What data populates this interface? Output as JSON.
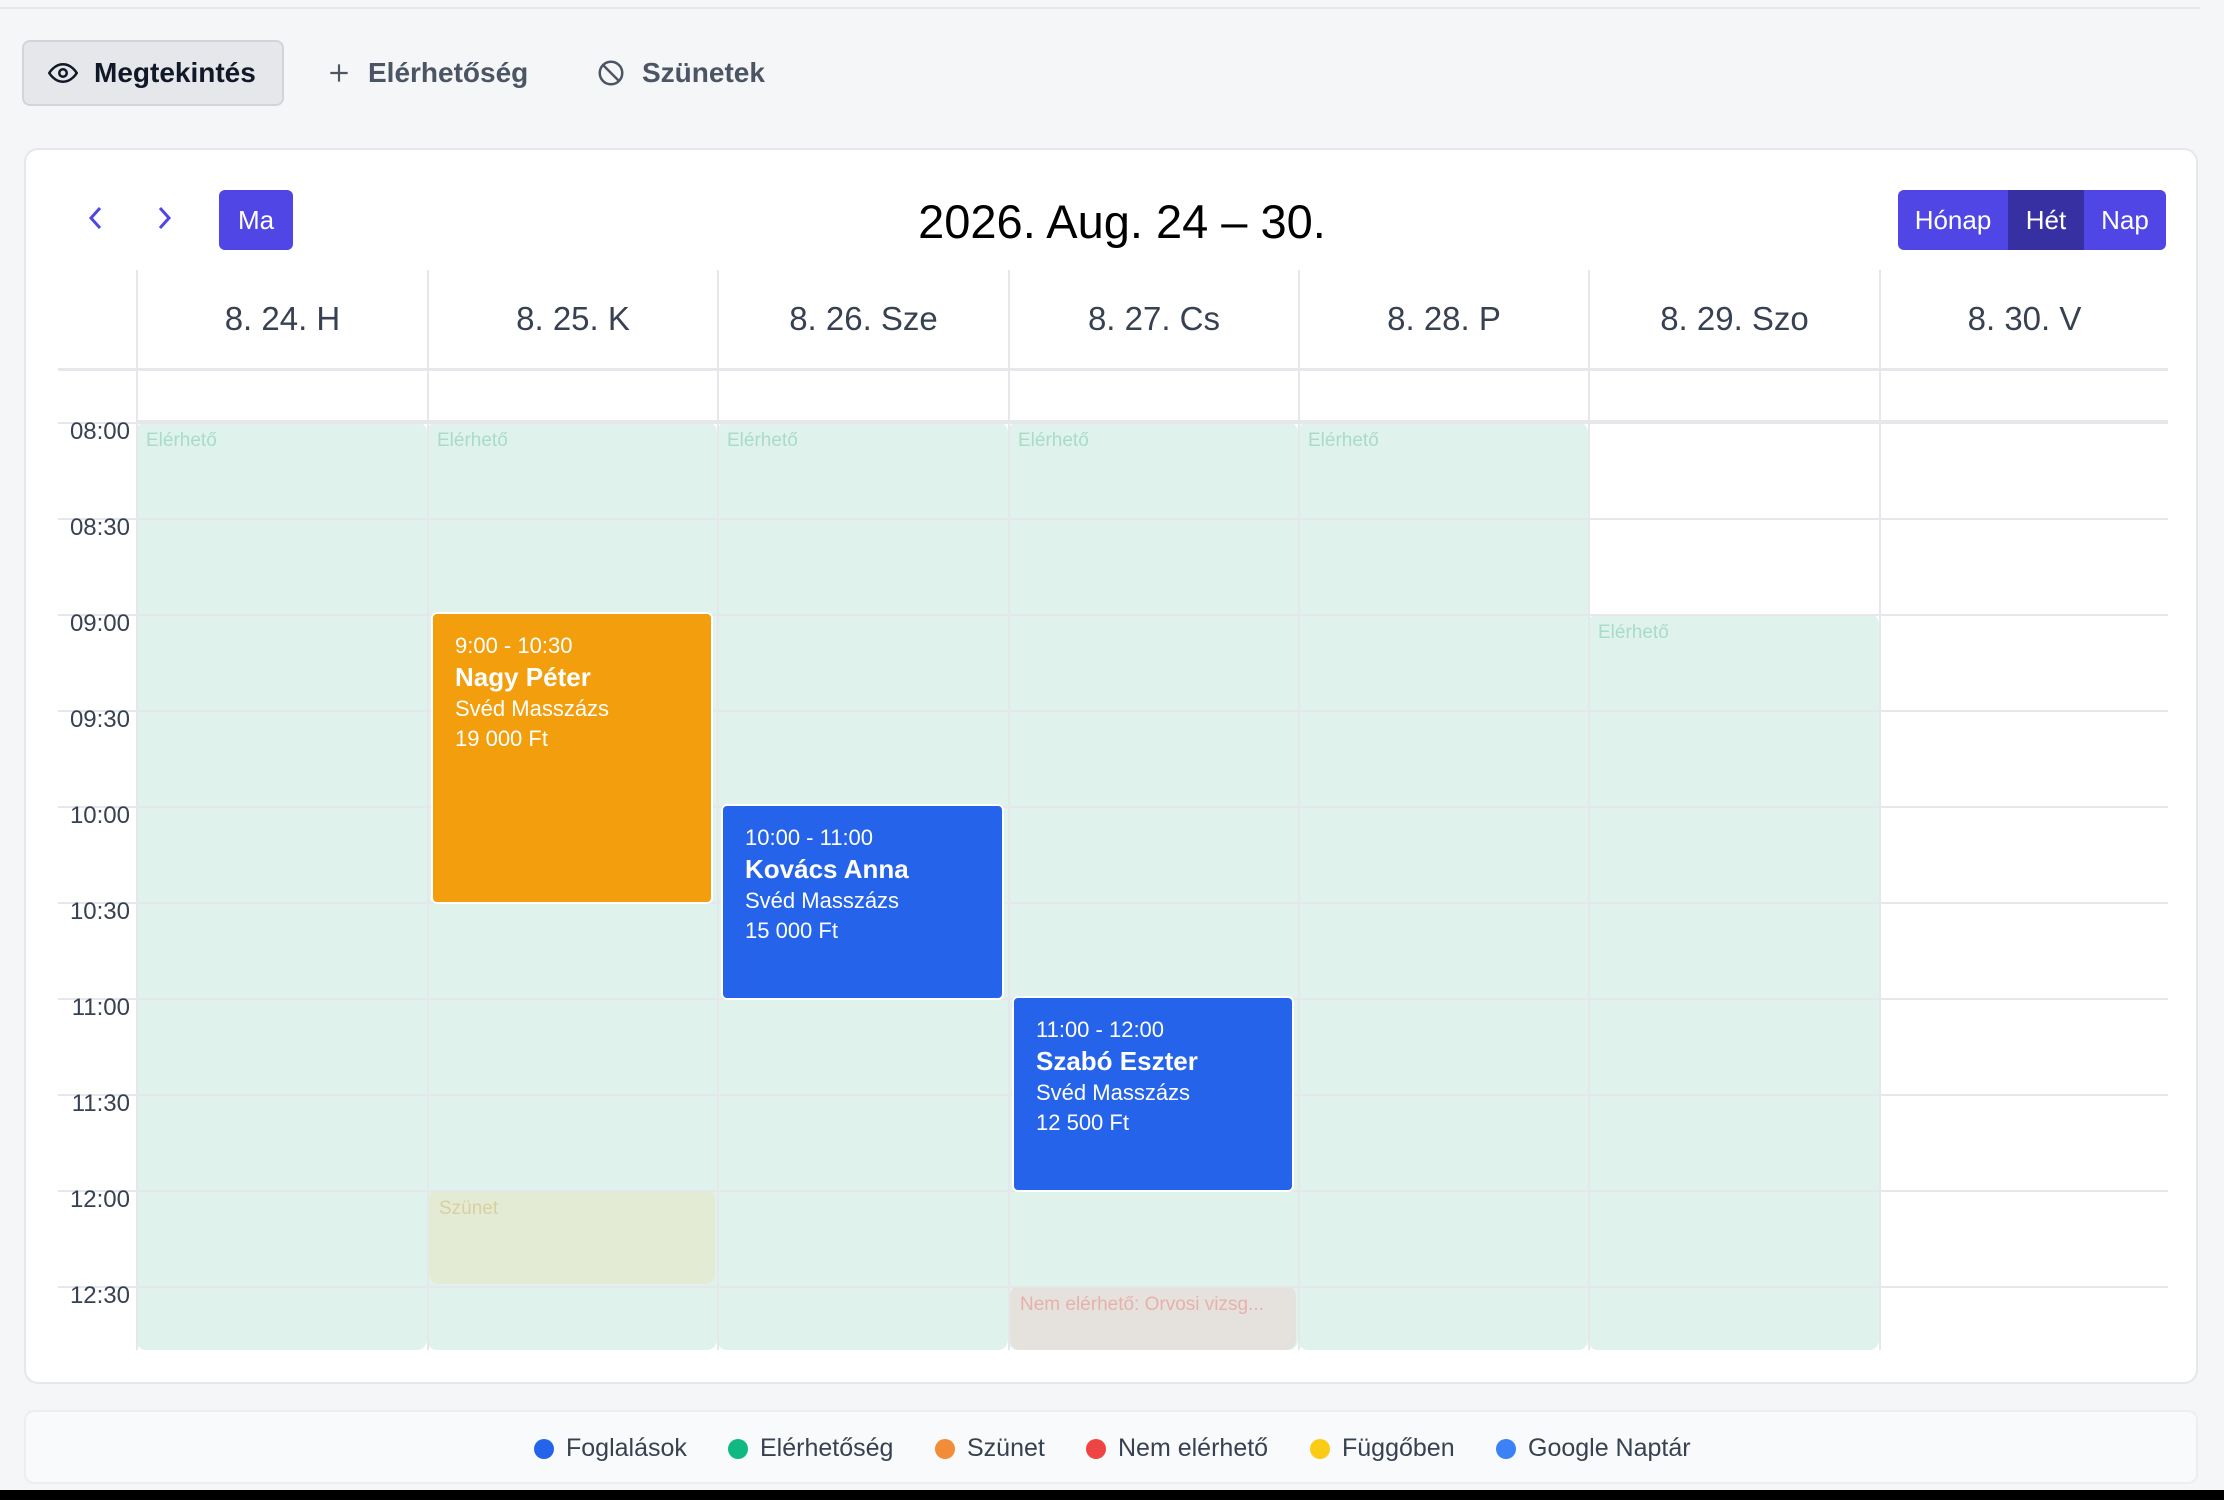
{
  "tabs": [
    {
      "label": "Megtekintés",
      "icon": "eye-icon",
      "active": true
    },
    {
      "label": "Elérhetőség",
      "icon": "plus-icon",
      "active": false
    },
    {
      "label": "Szünetek",
      "icon": "ban-icon",
      "active": false
    }
  ],
  "calendar": {
    "title": "2026. Aug. 24 – 30.",
    "today_label": "Ma",
    "views": [
      "Hónap",
      "Hét",
      "Nap"
    ],
    "active_view": "Hét",
    "days": [
      "8. 24. H",
      "8. 25. K",
      "8. 26. Sze",
      "8. 27. Cs",
      "8. 28. P",
      "8. 29. Szo",
      "8. 30. V"
    ],
    "times": [
      "08:00",
      "08:30",
      "09:00",
      "09:30",
      "10:00",
      "10:30",
      "11:00",
      "11:30",
      "12:00",
      "12:30"
    ],
    "availability_label": "Elérhető",
    "break_label": "Szünet",
    "unavailable_label": "Nem elérhető: Orvosi vizsg...",
    "events": [
      {
        "time": "9:00 - 10:30",
        "name": "Nagy Péter",
        "service": "Svéd Masszázs",
        "price": "19 000 Ft",
        "color": "#f29e0d"
      },
      {
        "time": "10:00 - 11:00",
        "name": "Kovács Anna",
        "service": "Svéd Masszázs",
        "price": "15 000 Ft",
        "color": "#2563eb"
      },
      {
        "time": "11:00 - 12:00",
        "name": "Szabó Eszter",
        "service": "Svéd Masszázs",
        "price": "12 500 Ft",
        "color": "#2563eb"
      }
    ]
  },
  "legend": [
    {
      "label": "Foglalások",
      "color": "#2563eb"
    },
    {
      "label": "Elérhetőség",
      "color": "#10b981"
    },
    {
      "label": "Szünet",
      "color": "#f28c38"
    },
    {
      "label": "Nem elérhető",
      "color": "#ef4444"
    },
    {
      "label": "Függőben",
      "color": "#facc15"
    },
    {
      "label": "Google Naptár",
      "color": "#3b82f6"
    }
  ],
  "colors": {
    "accent": "#4f46e5",
    "accent_active": "#3730a3",
    "availability": "#dff3ec",
    "break": "#e4ebd4",
    "unavailable": "#e5e2dd"
  }
}
